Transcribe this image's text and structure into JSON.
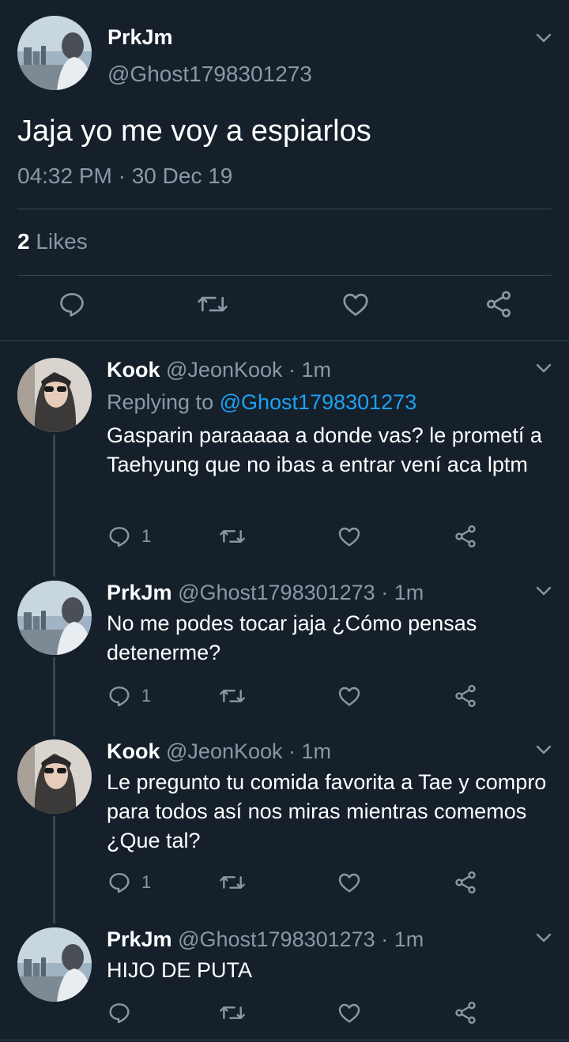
{
  "main": {
    "name": "PrkJm",
    "handle": "@Ghost1798301273",
    "text": "Jaja yo me voy a espiarlos",
    "timestamp": "04:32 PM · 30 Dec 19",
    "likes_count": "2",
    "likes_label": "Likes"
  },
  "replies": [
    {
      "name": "Kook",
      "handle": "@JeonKook",
      "time": "· 1m",
      "replying_prefix": "Replying to",
      "replying_to": "@Ghost1798301273",
      "text": "Gasparin paraaaaa a donde vas? le prometí a Taehyung que no ibas a entrar vení aca lptm",
      "reply_count": "1"
    },
    {
      "name": "PrkJm",
      "handle": "@Ghost1798301273",
      "time": "· 1m",
      "text": "No me podes tocar jaja ¿Cómo pensas detenerme?",
      "reply_count": "1"
    },
    {
      "name": "Kook",
      "handle": "@JeonKook",
      "time": "· 1m",
      "text": "Le pregunto tu comida favorita a Tae y compro para todos así nos miras mientras comemos ¿Que tal?",
      "reply_count": "1"
    },
    {
      "name": "PrkJm",
      "handle": "@Ghost1798301273",
      "time": "· 1m",
      "text": "HIJO DE PUTA",
      "reply_count": ""
    }
  ],
  "colors": {
    "background": "#15202b",
    "muted": "#8899a6",
    "accent": "#1da1f2",
    "divider": "#38444d"
  },
  "icons": [
    "chevron-down-icon",
    "reply-icon",
    "retweet-icon",
    "like-icon",
    "share-icon"
  ]
}
